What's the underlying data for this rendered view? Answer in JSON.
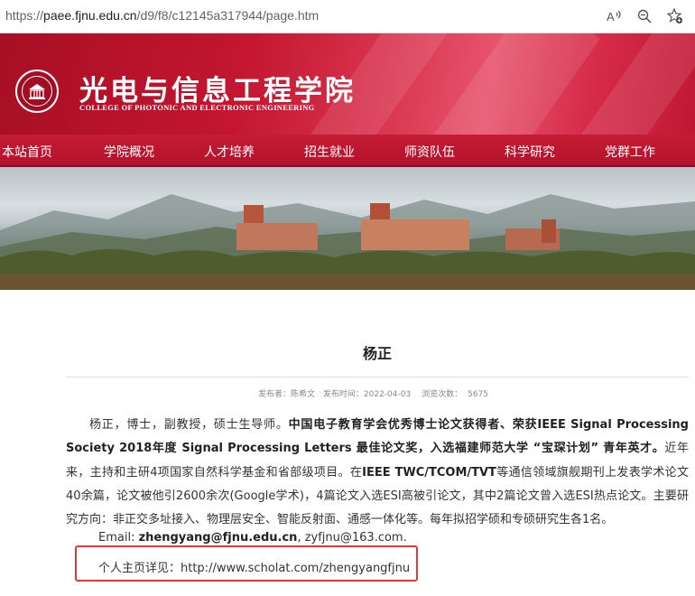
{
  "browser": {
    "url_prefix": "https://",
    "url_host": "paee.fjnu.edu.cn",
    "url_path": "/d9/f8/c12145a317944/page.htm",
    "icons": [
      "read-aloud-icon",
      "zoom-icon",
      "favorite-icon"
    ]
  },
  "header": {
    "title": "光电与信息工程学院",
    "subtitle": "COLLEGE OF PHOTONIC AND ELECTRONIC ENGINEERING"
  },
  "nav": {
    "items": [
      "本站首页",
      "学院概况",
      "人才培养",
      "招生就业",
      "师资队伍",
      "科学研究",
      "党群工作"
    ]
  },
  "article": {
    "title": "杨正",
    "meta": {
      "publisher": "发布者：陈希文",
      "date": "发布时间：2022-04-03",
      "views_label": "浏览次数：",
      "views": "5675"
    },
    "para_intro": "杨正，博士，副教授，硕士生导师。",
    "para_bold1": "中国电子教育学会优秀博士论文获得者、荣获IEEE Signal Processing Society 2018年度 Signal Processing Letters 最佳论文奖，入选福建师范大学 “宝琛计划” 青年英才。",
    "para_text1": "近年来，主持和主研4项国家自然科学基金和省部级项目。在",
    "para_bold2": "IEEE TWC/TCOM/TVT",
    "para_text2": "等通信领域旗舰期刊上发表学术论文40余篇，论文被他引2600余次(Google学术)，4篇论文入选ESI高被引论文，其中2篇论文曾入选ESI热点论文。主要研究方向：非正交多址接入、物理层安全、智能反射面、通感一体化等。每年拟招学硕和专硕研究生各1名。",
    "email_label": "Email: ",
    "email_primary": "zhengyang@fjnu.edu.cn",
    "email_secondary": ",  zyfjnu@163.com.",
    "homepage": "个人主页详见：http://www.scholat.com/zhengyangfjnu"
  },
  "colors": {
    "brand_red": "#c41630",
    "highlight_box": "#e53935"
  }
}
